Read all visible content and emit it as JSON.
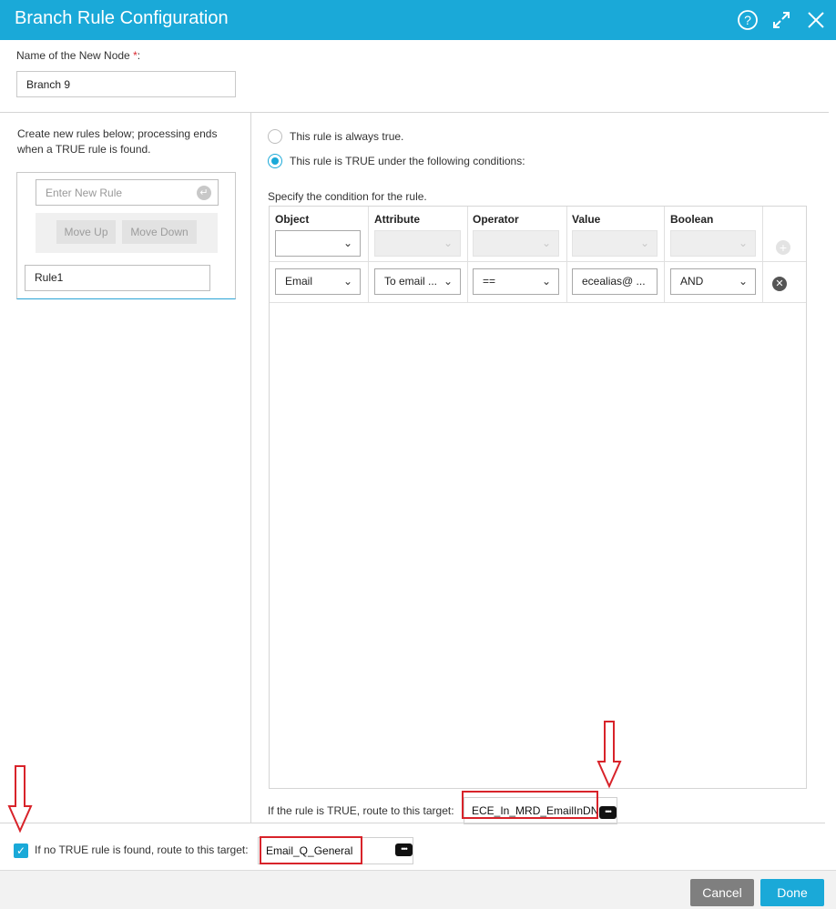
{
  "dialog": {
    "title": "Branch Rule Configuration",
    "icons": {
      "help": "help-circle-icon",
      "expand": "expand-icon",
      "close": "close-icon"
    }
  },
  "node_name": {
    "label": "Name of the New Node",
    "required_mark": "*",
    "label_suffix": ":",
    "value": "Branch 9"
  },
  "rules_panel": {
    "hint": "Create new rules below; processing ends when a TRUE rule is found.",
    "new_rule_placeholder": "Enter New Rule",
    "move_up": "Move Up",
    "move_down": "Move Down",
    "rules": [
      "Rule1"
    ]
  },
  "rule_mode": {
    "always_true": "This rule is always true.",
    "conditional": "This rule is TRUE under the following conditions:",
    "selected": "conditional"
  },
  "conditions": {
    "instruction": "Specify the condition for the rule.",
    "columns": [
      "Object",
      "Attribute",
      "Operator",
      "Value",
      "Boolean"
    ],
    "rows": [
      {
        "object": "Email",
        "attribute": "To email ...",
        "operator": "==",
        "value": "ecealias@ ...",
        "boolean": "AND"
      }
    ]
  },
  "true_target": {
    "label": "If the rule is TRUE, route to this target:",
    "value": "ECE_In_MRD_EmailInDN"
  },
  "fallback": {
    "checked": true,
    "label": "If no TRUE rule is found, route to this target:",
    "value": "Email_Q_General"
  },
  "footer": {
    "cancel": "Cancel",
    "done": "Done"
  },
  "colors": {
    "accent": "#1aa9d8",
    "highlight": "#d8232a",
    "cancel": "#7f7f7f"
  }
}
